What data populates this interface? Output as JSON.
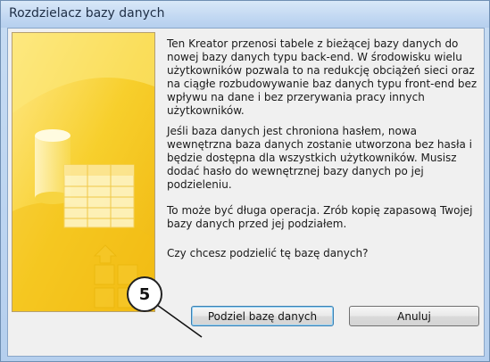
{
  "window": {
    "title": "Rozdzielacz bazy danych"
  },
  "content": {
    "paragraphs": [
      "Ten Kreator przenosi tabele z bieżącej bazy danych do nowej bazy danych typu back-end. W środowisku wielu użytkowników pozwala to na redukcję obciążeń sieci oraz na ciągłe rozbudowywanie baz danych typu front-end bez wpływu na dane i bez przerywania pracy innych użytkowników.",
      "Jeśli baza danych jest chroniona hasłem, nowa wewnętrzna baza danych zostanie utworzona bez hasła i będzie dostępna dla wszystkich użytkowników. Musisz dodać hasło do wewnętrznej bazy danych po jej podzieleniu.",
      "To może być długa operacja. Zrób kopię zapasową Twojej bazy danych przed jej podziałem.",
      "Czy chcesz podzielić tę bazę danych?"
    ]
  },
  "buttons": {
    "split_label": "Podziel bazę danych",
    "cancel_label": "Anuluj"
  },
  "annotation": {
    "step_number": "5"
  },
  "colors": {
    "panel_yellow": "#f6c61c",
    "panel_light": "#fff3a8",
    "focus_border": "#3c7fb1"
  },
  "icons": {
    "illustration": "database-table-illustration"
  }
}
